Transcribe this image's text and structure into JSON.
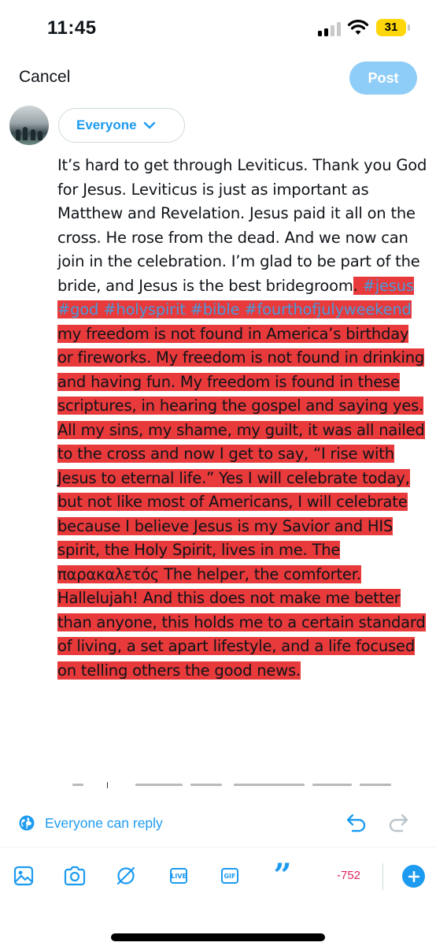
{
  "status_bar": {
    "time": "11:45",
    "battery": "31"
  },
  "header": {
    "cancel_label": "Cancel",
    "post_label": "Post"
  },
  "composer": {
    "audience_label": "Everyone",
    "text_plain": "It’s hard to get through Leviticus. Thank you God for Jesus. Leviticus is just as important as Matthew and Revelation. Jesus paid it all on the cross. He rose from the dead. And we now can join in the celebration. I’m glad to be part of the bride, and Jesus is the best bridegroom",
    "text_period": ". ",
    "hashtags": "#jesus #god #holyspirit #bible #fourthofjulyweekend",
    "text_highlighted": " my freedom is not found in America’s birthday or fireworks. My freedom is not found in drinking and having fun. My freedom is found in these scriptures, in hearing the gospel and saying yes. All my sins, my shame, my guilt, it was all nailed to the cross and now I get to say, “I rise with Jesus to eternal life.” Yes I will celebrate today, but not like most of Americans, I will celebrate because I believe Jesus is my Savior and HIS spirit, the Holy Spirit, lives in me. The παρακαλετός The helper, the comforter. Hallelujah!  And this does not make me better than anyone, this holds me to a certain standard of living, a set apart lifestyle, and a life focused on telling others the good news."
  },
  "reply_settings": {
    "label": "Everyone can reply",
    "icon": "globe-icon"
  },
  "toolbar": {
    "icons": [
      "image-icon",
      "camera-icon",
      "gif-search-icon",
      "live-icon",
      "gif-icon",
      "quote-icon"
    ],
    "live_label": "LIVE",
    "gif_label": "GIF",
    "char_count": "-752"
  },
  "colors": {
    "accent": "#1d9bf0",
    "post_disabled": "#8ecdf8",
    "highlight": "#e8393b",
    "hashtag": "#4a9ad8",
    "over_limit": "#e0245e"
  }
}
